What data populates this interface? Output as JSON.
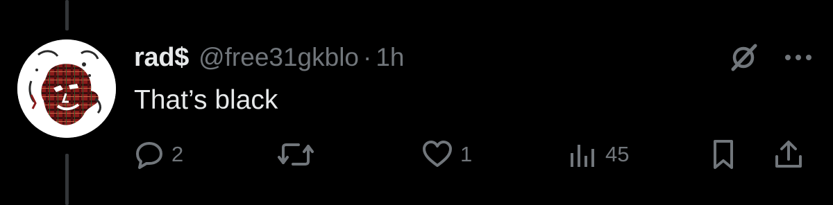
{
  "tweet": {
    "display_name": "rad$",
    "handle": "@free31gkblo",
    "separator": "·",
    "time": "1h",
    "text": "That’s black"
  },
  "actions": {
    "replies": "2",
    "retweets": "",
    "likes": "1",
    "views": "45"
  },
  "icons": {
    "avatar": "avatar-image",
    "grok": "grok-icon",
    "more": "more-horizontal-icon",
    "reply": "reply-bubble-icon",
    "retweet": "retweet-icon",
    "like": "heart-icon",
    "views": "bar-chart-icon",
    "bookmark": "bookmark-icon",
    "share": "share-upload-icon"
  },
  "colors": {
    "background": "#000000",
    "primary_text": "#e7e9ea",
    "secondary_text": "#71767b",
    "thread_line": "#333639"
  }
}
